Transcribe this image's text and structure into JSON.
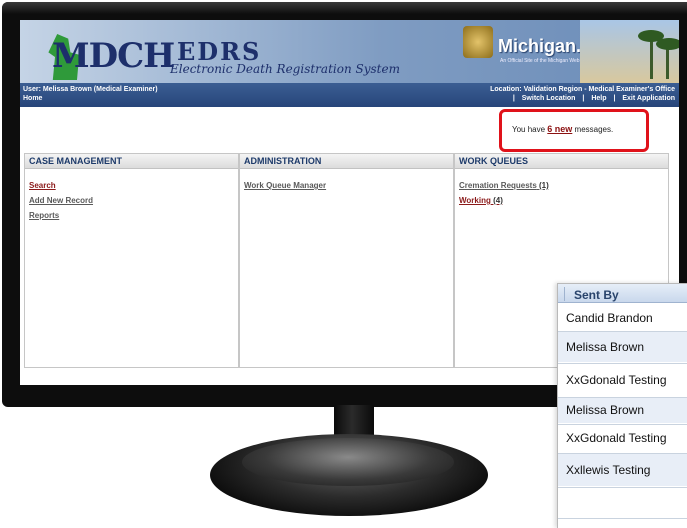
{
  "banner": {
    "logo_text": "MDCH",
    "system_title": "EDRS",
    "system_subtitle": "Electronic Death Registration System",
    "state_logo": "Michigan.gov",
    "state_tagline": "An Official Site of the Michigan Web Site"
  },
  "infobar": {
    "user": "User: Melissa Brown (Medical Examiner)",
    "home_link": "Home",
    "location": "Location: Validation Region - Medical Examiner's Office",
    "links": [
      "Switch Location",
      "Help",
      "Exit Application"
    ]
  },
  "messages": {
    "prefix": "You have ",
    "count": "6 new",
    "suffix": " messages."
  },
  "panels": {
    "case_management": {
      "title": "CASE MANAGEMENT",
      "links": [
        "Search",
        "Add New Record",
        "Reports"
      ]
    },
    "administration": {
      "title": "ADMINISTRATION",
      "links": [
        "Work Queue Manager"
      ]
    },
    "work_queues": {
      "title": "WORK QUEUES",
      "links": [
        {
          "label": "Cremation Requests",
          "count": " (1)"
        },
        {
          "label": "Working",
          "count": " (4)"
        }
      ]
    }
  },
  "sent_by": {
    "header": "Sent By",
    "rows": [
      "Candid Brandon",
      "Melissa Brown",
      "XxGdonald Testing",
      "Melissa Brown",
      "XxGdonald Testing",
      "Xxllewis Testing"
    ]
  },
  "colors": {
    "highlight_border": "#e0121a",
    "header_blue": "#27457a",
    "link_red": "#8b1a1a"
  }
}
